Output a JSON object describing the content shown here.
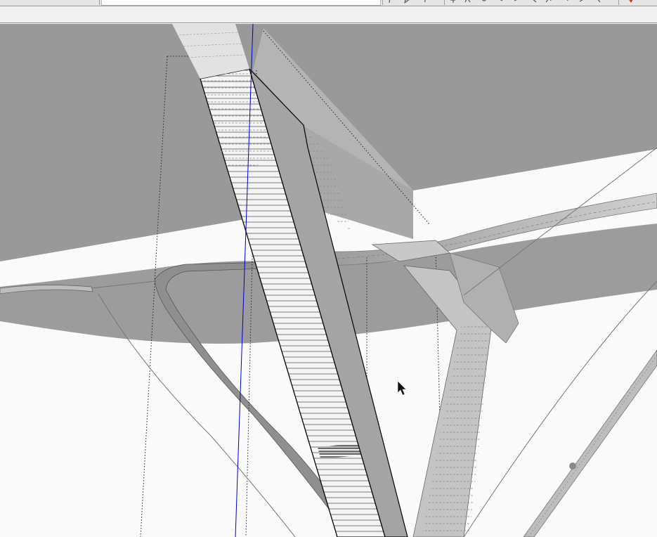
{
  "app": {
    "toolbar_field_value": "",
    "toolbar_icons": [
      "arc-tool-icon",
      "pie-tool-icon",
      "rotate-tool-icon",
      "move-tool-icon",
      "push-pull-tool-icon",
      "follow-me-tool-icon",
      "offset-tool-icon",
      "scale-tool-icon",
      "tape-measure-icon",
      "protractor-icon",
      "axes-tool-icon",
      "dimension-tool-icon",
      "section-plane-icon",
      "ruby-console-icon"
    ]
  },
  "viewport": {
    "background_color": "#fafafa",
    "surface_color": "#999999",
    "face_light_color": "#c4c4c4",
    "edge_color": "#000000",
    "axis_color": "#0000cc",
    "cursor": "arrow-cursor-icon"
  }
}
